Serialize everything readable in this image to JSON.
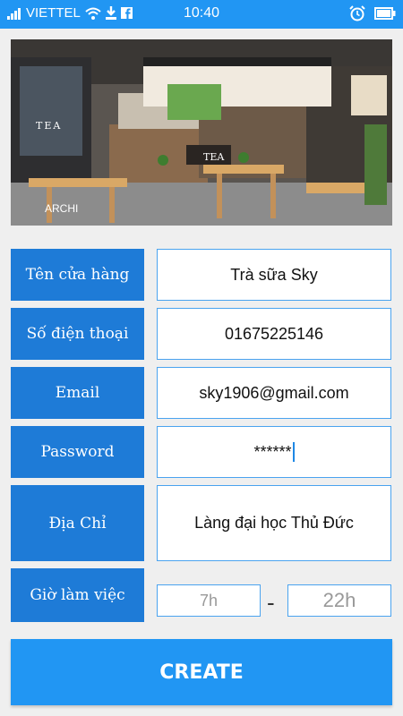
{
  "status_bar": {
    "carrier": "VIETTEL",
    "time": "10:40",
    "icons": [
      "signal-icon",
      "wifi-icon",
      "download-icon",
      "facebook-icon",
      "alarm-icon",
      "battery-icon"
    ]
  },
  "hero": {
    "sign_left": "TEA",
    "sign_counter": "TEA",
    "watermark": "ARCHI"
  },
  "form": {
    "store_name_label": "Tên cửa hàng",
    "store_name_value": "Trà sữa Sky",
    "phone_label": "Số điện thoại",
    "phone_value": "01675225146",
    "email_label": "Email",
    "email_value": "sky1906@gmail.com",
    "password_label": "Password",
    "password_value": "******",
    "address_label": "Địa Chỉ",
    "address_value": "Làng đại học Thủ Đức",
    "hours_label": "Giờ làm việc",
    "open_hour": "7h",
    "close_hour": "22h",
    "separator": "-"
  },
  "create_label": "CREATE",
  "colors": {
    "primary": "#2196f3",
    "label_bg": "#1e7bd7",
    "input_border": "#4aa3ef",
    "background": "#efefef"
  }
}
